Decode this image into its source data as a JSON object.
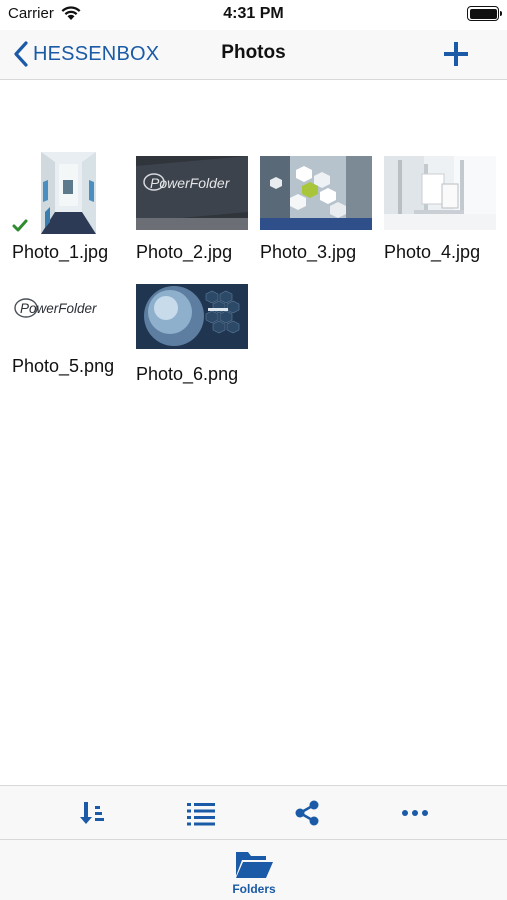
{
  "status_bar": {
    "carrier": "Carrier",
    "time": "4:31 PM",
    "wifi_icon": "wifi-icon",
    "battery_icon": "battery-icon"
  },
  "nav": {
    "back_label": "HESSENBOX",
    "title": "Photos",
    "back_icon": "chevron-left-icon",
    "add_icon": "plus-icon"
  },
  "files": [
    {
      "name": "Photo_1.jpg",
      "synced": true
    },
    {
      "name": "Photo_2.jpg",
      "synced": false
    },
    {
      "name": "Photo_3.jpg",
      "synced": false
    },
    {
      "name": "Photo_4.jpg",
      "synced": false
    },
    {
      "name": "Photo_5.png",
      "synced": false
    },
    {
      "name": "Photo_6.png",
      "synced": false
    }
  ],
  "thumbnails": {
    "photo_2_logo": "PowerFolder",
    "photo_5_logo": "PowerFolder"
  },
  "toolbar": {
    "icons": [
      "sort-icon",
      "list-view-icon",
      "share-icon",
      "more-icon"
    ]
  },
  "tab_bar": {
    "folders_label": "Folders",
    "folders_icon": "folder-open-icon"
  },
  "colors": {
    "accent": "#1a5aa6",
    "check": "#2e8b2e",
    "bar_background": "#f8f8f8"
  }
}
